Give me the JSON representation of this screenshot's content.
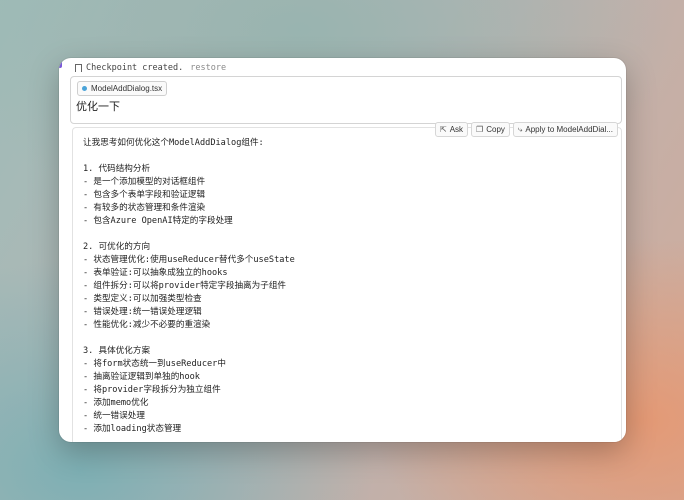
{
  "checkpoint": {
    "text": "Checkpoint created.",
    "restore": "restore"
  },
  "attachment": {
    "filename": "ModelAddDialog.tsx"
  },
  "query": "优化一下",
  "actions": {
    "ask": "Ask",
    "copy": "Copy",
    "apply": "Apply to ModelAddDial..."
  },
  "response": {
    "intro": "让我思考如何优化这个ModelAddDialog组件:",
    "sections": [
      {
        "heading": "1. 代码结构分析",
        "items": [
          "- 是一个添加模型的对话框组件",
          "- 包含多个表单字段和验证逻辑",
          "- 有较多的状态管理和条件渲染",
          "- 包含Azure OpenAI特定的字段处理"
        ]
      },
      {
        "heading": "2. 可优化的方向",
        "items": [
          "- 状态管理优化:使用useReducer替代多个useState",
          "- 表单验证:可以抽象成独立的hooks",
          "- 组件拆分:可以将provider特定字段抽离为子组件",
          "- 类型定义:可以加强类型检查",
          "- 错误处理:统一错误处理逻辑",
          "- 性能优化:减少不必要的重渲染"
        ]
      },
      {
        "heading": "3. 具体优化方案",
        "items": [
          "- 将form状态统一到useReducer中",
          "- 抽离验证逻辑到单独的hook",
          "- 将provider字段拆分为独立组件",
          "- 添加memo优化",
          "- 统一错误处理",
          "- 添加loading状态管理"
        ]
      }
    ]
  }
}
